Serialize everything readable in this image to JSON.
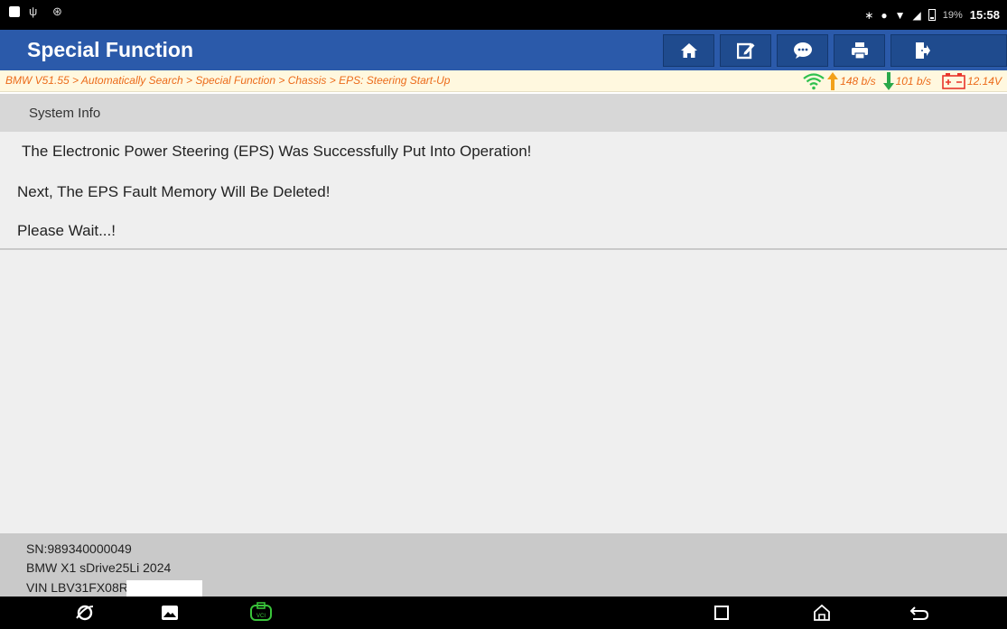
{
  "status_bar": {
    "icons_left": [
      "image-icon",
      "usb-icon",
      "bluetooth-scan-icon"
    ],
    "icons_right": [
      "bluetooth-icon",
      "dnd-icon",
      "wifi-icon",
      "signal-icon",
      "battery-icon"
    ],
    "battery": "19%",
    "time": "15:58"
  },
  "header": {
    "title": "Special Function",
    "toolbar": [
      "home-icon",
      "edit-icon",
      "chat-icon",
      "print-icon",
      "exit-icon"
    ]
  },
  "breadcrumb": {
    "path": "BMW V51.55 > Automatically Search > Special Function > Chassis > EPS: Steering Start-Up",
    "upload_rate": "148 b/s",
    "download_rate": "101 b/s",
    "voltage": "12.14V"
  },
  "section": {
    "title": "System Info"
  },
  "messages": {
    "line1": "The Electronic Power Steering (EPS) Was Successfully Put Into Operation!",
    "line2": "Next, The EPS Fault Memory Will Be Deleted!",
    "line3": "Please Wait...!"
  },
  "footer": {
    "sn": "SN:989340000049",
    "vehicle": "BMW X1 sDrive25Li 2024",
    "vin": "VIN LBV31FX08R"
  },
  "nav_bar": {
    "buttons": [
      "browser-icon",
      "gallery-icon",
      "vci-icon",
      "recents-button",
      "home-button",
      "back-button"
    ]
  },
  "colors": {
    "title_bar": "#2b5aaa",
    "breadcrumb_text": "#ec6b1a",
    "breadcrumb_bg": "#fff8df",
    "upload_arrow": "#f2a11a",
    "download_arrow": "#2aa84a",
    "wifi": "#2ec14e",
    "vci_icon": "#39c43a"
  }
}
